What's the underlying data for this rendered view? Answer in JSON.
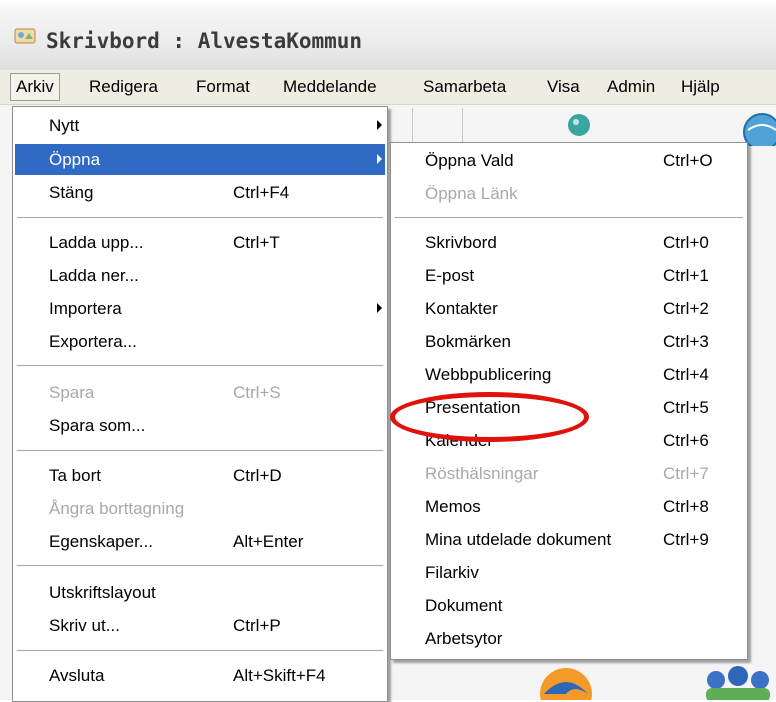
{
  "window": {
    "title": "Skrivbord : AlvestaKommun",
    "icon": "desktop-icon"
  },
  "menubar": {
    "items": [
      "Arkiv",
      "Redigera",
      "Format",
      "Meddelande",
      "Samarbeta",
      "Visa",
      "Admin",
      "Hjälp"
    ],
    "active": "Arkiv"
  },
  "arkiv_menu": {
    "items": [
      {
        "label": "Nytt",
        "shortcut": "",
        "submenu": true
      },
      {
        "label": "Öppna",
        "shortcut": "",
        "submenu": true,
        "highlighted": true
      },
      {
        "label": "Stäng",
        "shortcut": "Ctrl+F4"
      },
      {
        "label": "Ladda upp...",
        "shortcut": "Ctrl+T"
      },
      {
        "label": "Ladda ner...",
        "shortcut": ""
      },
      {
        "label": "Importera",
        "shortcut": "",
        "submenu": true
      },
      {
        "label": "Exportera...",
        "shortcut": ""
      },
      {
        "label": "Spara",
        "shortcut": "Ctrl+S",
        "disabled": true
      },
      {
        "label": "Spara som...",
        "shortcut": ""
      },
      {
        "label": "Ta bort",
        "shortcut": "Ctrl+D"
      },
      {
        "label": "Ångra borttagning",
        "shortcut": "",
        "disabled": true
      },
      {
        "label": "Egenskaper...",
        "shortcut": "Alt+Enter"
      },
      {
        "label": "Utskriftslayout",
        "shortcut": ""
      },
      {
        "label": "Skriv ut...",
        "shortcut": "Ctrl+P"
      },
      {
        "label": "Avsluta",
        "shortcut": "Alt+Skift+F4"
      }
    ]
  },
  "oppna_submenu": {
    "items": [
      {
        "label": "Öppna Vald",
        "shortcut": "Ctrl+O"
      },
      {
        "label": "Öppna Länk",
        "shortcut": "",
        "disabled": true
      },
      {
        "label": "Skrivbord",
        "shortcut": "Ctrl+0"
      },
      {
        "label": "E-post",
        "shortcut": "Ctrl+1"
      },
      {
        "label": "Kontakter",
        "shortcut": "Ctrl+2"
      },
      {
        "label": "Bokmärken",
        "shortcut": "Ctrl+3"
      },
      {
        "label": "Webbpublicering",
        "shortcut": "Ctrl+4"
      },
      {
        "label": "Presentation",
        "shortcut": "Ctrl+5",
        "annotated": true
      },
      {
        "label": "Kalender",
        "shortcut": "Ctrl+6"
      },
      {
        "label": "Rösthälsningar",
        "shortcut": "Ctrl+7",
        "disabled": true
      },
      {
        "label": "Memos",
        "shortcut": "Ctrl+8"
      },
      {
        "label": "Mina utdelade dokument",
        "shortcut": "Ctrl+9"
      },
      {
        "label": "Filarkiv",
        "shortcut": ""
      },
      {
        "label": "Dokument",
        "shortcut": ""
      },
      {
        "label": "Arbetsytor",
        "shortcut": ""
      }
    ]
  },
  "colors": {
    "highlight": "#316ac5",
    "annotation": "#e0120c",
    "disabled_text": "#a9a9a9",
    "menubar_bg": "#efece2"
  }
}
